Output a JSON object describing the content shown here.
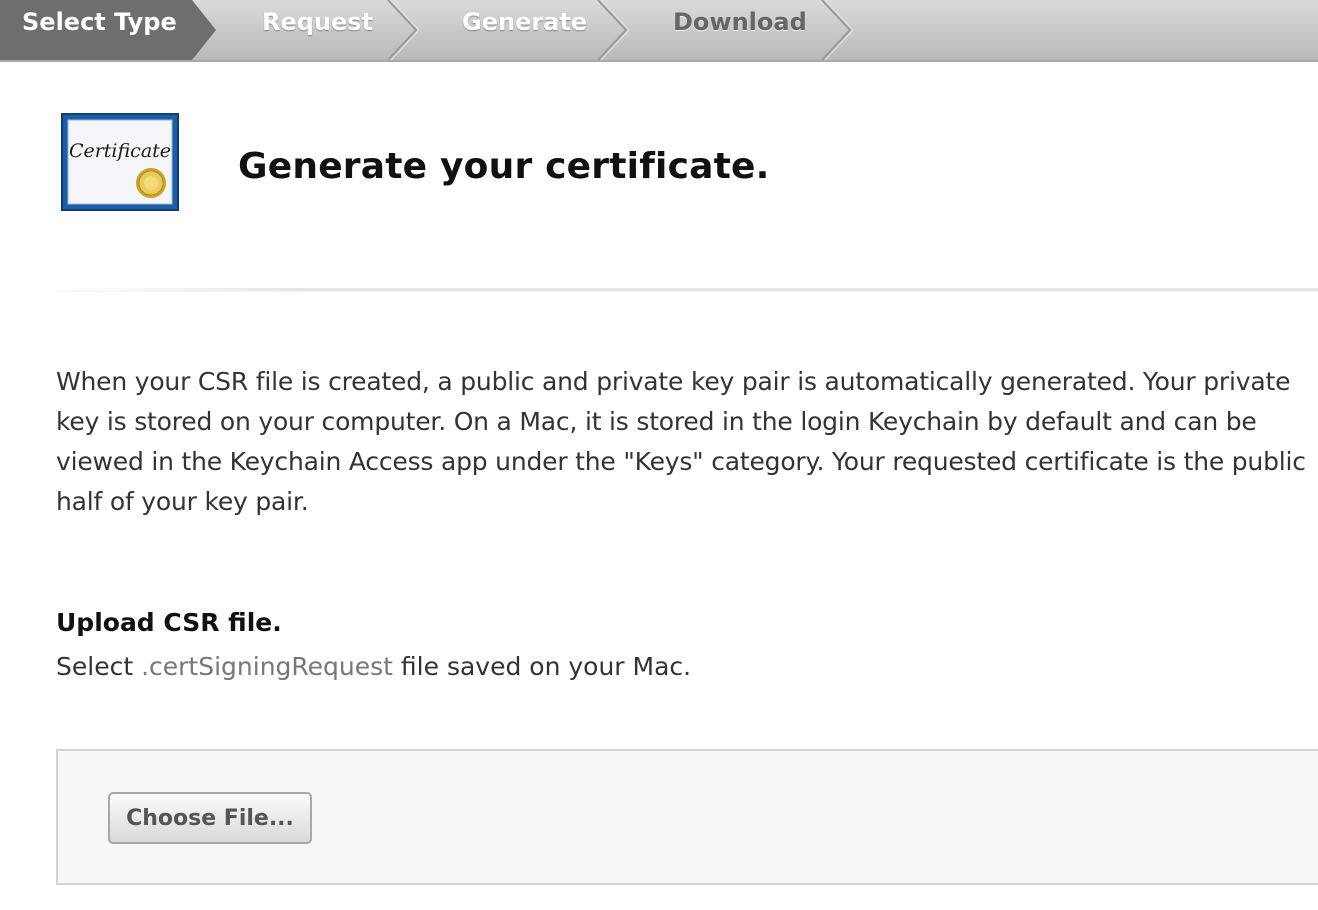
{
  "steps": [
    {
      "label": "Select Type",
      "state": "active"
    },
    {
      "label": "Request",
      "state": "completed"
    },
    {
      "label": "Generate",
      "state": "current"
    },
    {
      "label": "Download",
      "state": "upcoming"
    }
  ],
  "header": {
    "icon_text": "Certificate",
    "title": "Generate your certificate."
  },
  "description": "When your CSR file is created, a public and private key pair is automatically generated. Your private key is stored on your computer. On a Mac, it is stored in the login Keychain by default and can be viewed in the Keychain Access app under the \"Keys\" category. Your requested certificate is the public half of your key pair.",
  "upload": {
    "heading": "Upload CSR file.",
    "instruction_prefix": "Select ",
    "instruction_ext": ".certSigningRequest",
    "instruction_suffix": " file saved on your Mac.",
    "button_label": "Choose File..."
  },
  "colors": {
    "active_step": "#6e6e6e",
    "stepbar": "#c8c8c8",
    "icon_blue": "#1a5ea8",
    "seal_gold": "#d8b53a"
  }
}
